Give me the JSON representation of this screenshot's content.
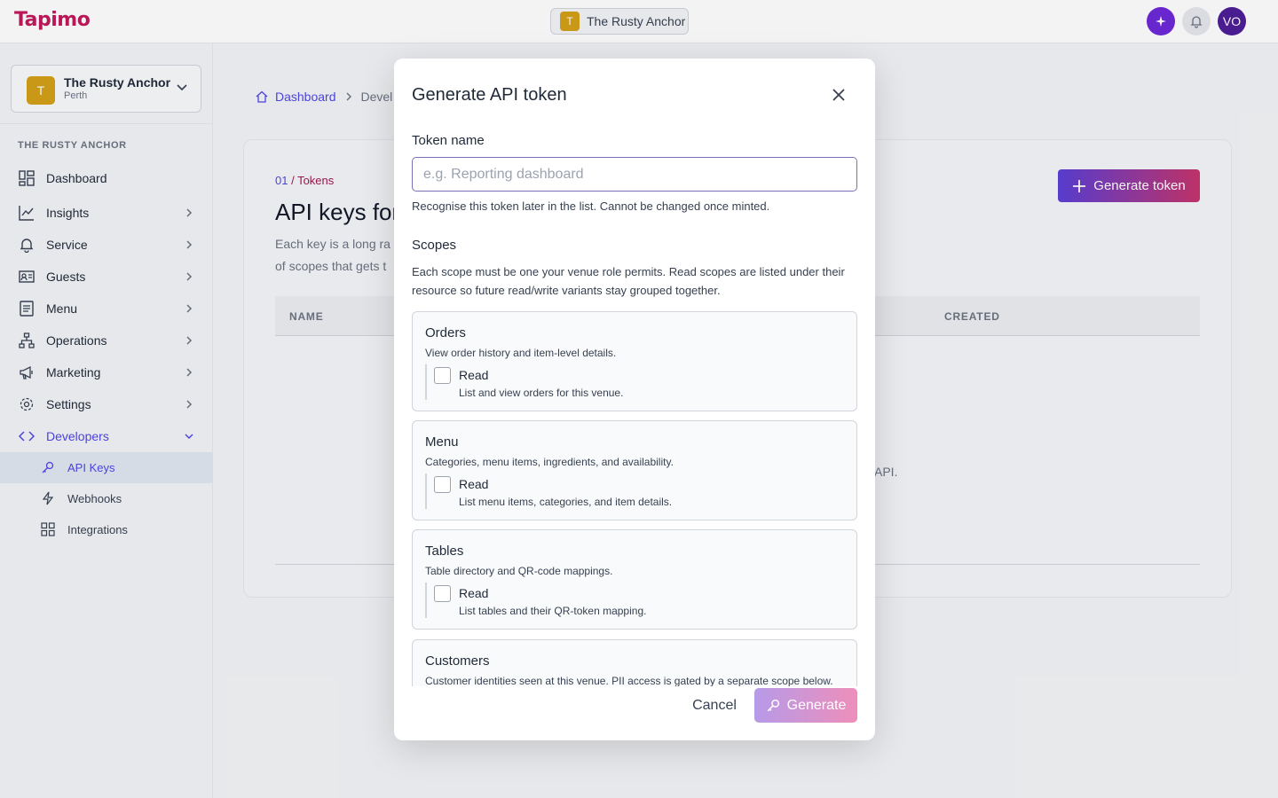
{
  "app": {
    "logo": "Tapimo"
  },
  "topbar": {
    "venue_initial": "T",
    "venue_name": "The Rusty Anchor",
    "avatar_initials": "VO"
  },
  "sidebar": {
    "venue_initial": "T",
    "venue_name": "The Rusty Anchor",
    "venue_city": "Perth",
    "section_label": "THE RUSTY ANCHOR",
    "items": [
      {
        "label": "Dashboard",
        "icon": "dashboard-icon"
      },
      {
        "label": "Insights",
        "icon": "chart-icon"
      },
      {
        "label": "Service",
        "icon": "bell-icon"
      },
      {
        "label": "Guests",
        "icon": "id-card-icon"
      },
      {
        "label": "Menu",
        "icon": "menu-icon"
      },
      {
        "label": "Operations",
        "icon": "network-icon"
      },
      {
        "label": "Marketing",
        "icon": "megaphone-icon"
      },
      {
        "label": "Settings",
        "icon": "gear-icon"
      },
      {
        "label": "Developers",
        "icon": "code-icon"
      }
    ],
    "sub_items": [
      {
        "label": "API Keys",
        "icon": "key-icon"
      },
      {
        "label": "Webhooks",
        "icon": "bolt-icon"
      },
      {
        "label": "Integrations",
        "icon": "grid-icon"
      }
    ]
  },
  "breadcrumb": {
    "home": "Dashboard",
    "current": "Devel"
  },
  "main": {
    "eyebrow_num": "01",
    "eyebrow_sep": " / ",
    "eyebrow_text": "Tokens",
    "title": "API keys for",
    "desc_line1": "Each key is a long ra",
    "desc_line2": "of scopes that gets t",
    "generate_label": "Generate token",
    "columns": {
      "name": "NAME",
      "created": "CREATED"
    },
    "empty_fragment": "API."
  },
  "modal": {
    "title": "Generate API token",
    "token_label": "Token name",
    "token_placeholder": "e.g. Reporting dashboard",
    "token_value": "",
    "token_help": "Recognise this token later in the list. Cannot be changed once minted.",
    "scopes_label": "Scopes",
    "scopes_desc": "Each scope must be one your venue role permits. Read scopes are listed under their resource so future read/write variants stay grouped together.",
    "scopes": [
      {
        "title": "Orders",
        "desc": "View order history and item-level details.",
        "perm": "Read",
        "perm_desc": "List and view orders for this venue.",
        "checked": false
      },
      {
        "title": "Menu",
        "desc": "Categories, menu items, ingredients, and availability.",
        "perm": "Read",
        "perm_desc": "List menu items, categories, and item details.",
        "checked": false
      },
      {
        "title": "Tables",
        "desc": "Table directory and QR-code mappings.",
        "perm": "Read",
        "perm_desc": "List tables and their QR-token mapping.",
        "checked": false
      },
      {
        "title": "Customers",
        "desc": "Customer identities seen at this venue. PII access is gated by a separate scope below.",
        "perm": "",
        "perm_desc": "",
        "checked": false
      }
    ],
    "cancel_label": "Cancel",
    "generate_label": "Generate"
  },
  "colors": {
    "brand": "#c2185b",
    "accent": "#4f46e5",
    "venue_badge": "#d4a017",
    "gradient_start": "#5b3fd6",
    "gradient_end": "#c7336b"
  }
}
